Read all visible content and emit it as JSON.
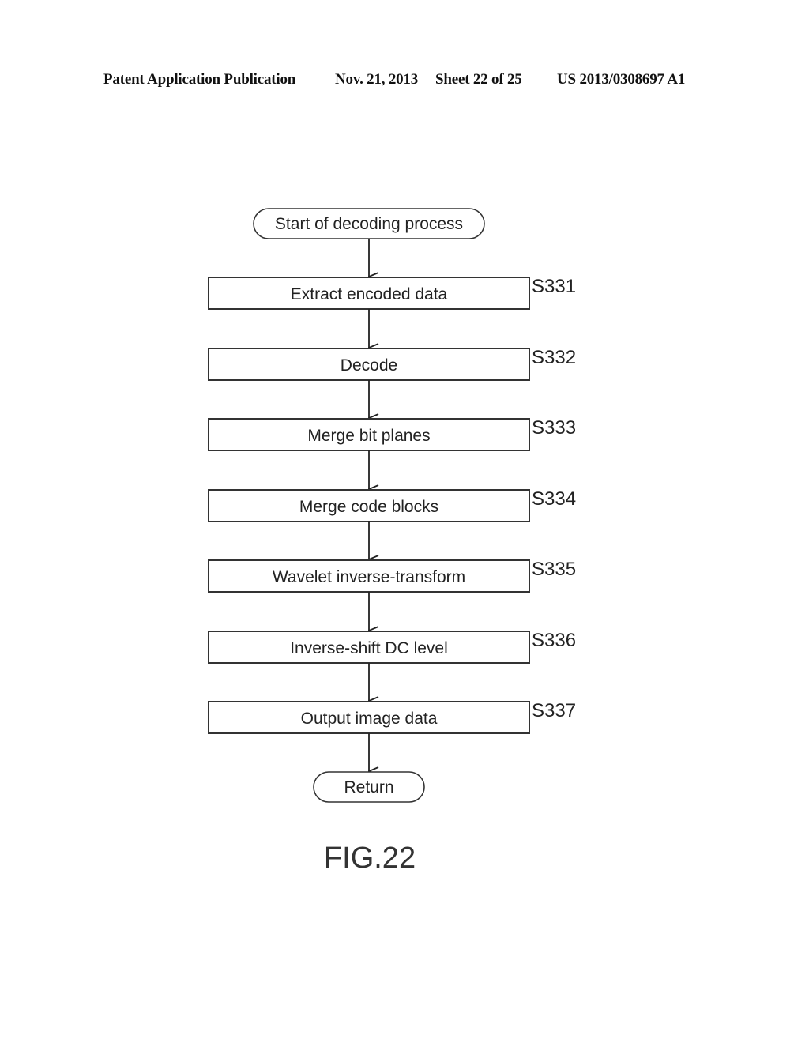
{
  "header": {
    "publication": "Patent Application Publication",
    "date": "Nov. 21, 2013",
    "sheet": "Sheet 22 of 25",
    "number": "US 2013/0308697 A1"
  },
  "flowchart": {
    "start": "Start of decoding process",
    "steps": [
      {
        "id": "S331",
        "label": "Extract encoded data"
      },
      {
        "id": "S332",
        "label": "Decode"
      },
      {
        "id": "S333",
        "label": "Merge bit planes"
      },
      {
        "id": "S334",
        "label": "Merge code blocks"
      },
      {
        "id": "S335",
        "label": "Wavelet inverse-transform"
      },
      {
        "id": "S336",
        "label": "Inverse-shift DC level"
      },
      {
        "id": "S337",
        "label": "Output image data"
      }
    ],
    "end": "Return"
  },
  "figure_label": "FIG.22"
}
